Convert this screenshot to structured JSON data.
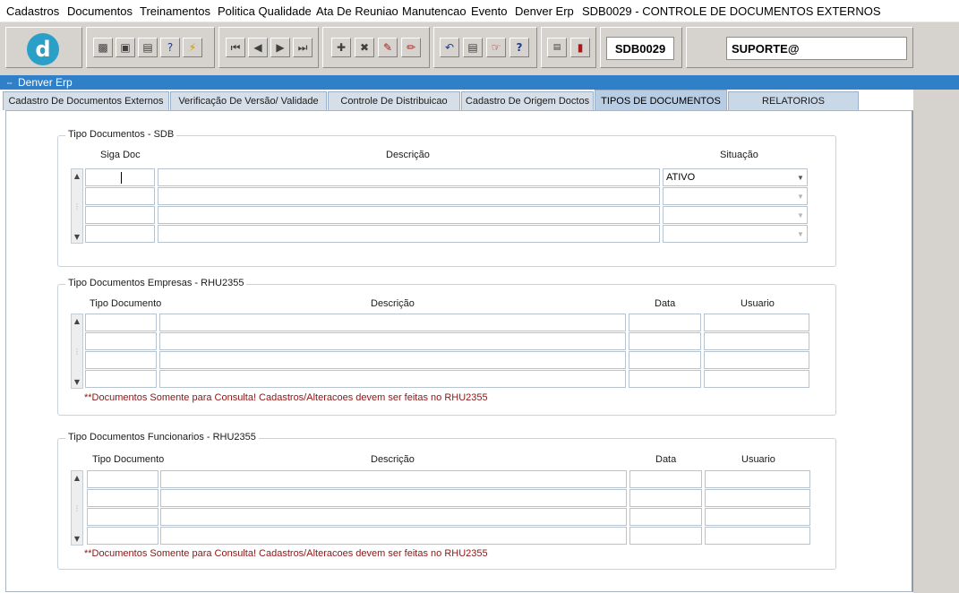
{
  "menubar": {
    "items": [
      "Cadastros",
      "Documentos",
      "Treinamentos",
      "Politica Qualidade",
      "Ata De Reuniao",
      "Manutencao",
      "Evento",
      "Denver Erp"
    ],
    "title": "SDB0029 - CONTROLE DE DOCUMENTOS EXTERNOS"
  },
  "toolbar": {
    "form_code": "SDB0029",
    "user": "SUPORTE@",
    "logo_letter": "d"
  },
  "window": {
    "title": "Denver Erp"
  },
  "tabs": [
    {
      "label": "Cadastro De Documentos Externos",
      "active": false
    },
    {
      "label": "Verificação De Versão/ Validade",
      "active": false
    },
    {
      "label": "Controle De Distribuicao",
      "active": false
    },
    {
      "label": "Cadastro De Origem Doctos",
      "active": false
    },
    {
      "label": "TIPOS DE DOCUMENTOS",
      "active": true
    },
    {
      "label": "RELATORIOS",
      "active": false
    }
  ],
  "section_sdb": {
    "title": "Tipo Documentos - SDB",
    "columns": [
      "Siga Doc",
      "Descrição",
      "Situação"
    ],
    "rows": [
      {
        "siga_doc": "",
        "descricao": "",
        "situacao": "ATIVO"
      },
      {
        "siga_doc": "",
        "descricao": "",
        "situacao": ""
      },
      {
        "siga_doc": "",
        "descricao": "",
        "situacao": ""
      },
      {
        "siga_doc": "",
        "descricao": "",
        "situacao": ""
      }
    ]
  },
  "section_empresas": {
    "title": "Tipo Documentos Empresas - RHU2355",
    "columns": [
      "Tipo Documento",
      "Descrição",
      "Data",
      "Usuario"
    ],
    "note": "**Documentos Somente para Consulta! Cadastros/Alteracoes devem ser feitas no RHU2355"
  },
  "section_funcionarios": {
    "title": "Tipo Documentos Funcionarios - RHU2355",
    "columns": [
      "Tipo Documento",
      "Descrição",
      "Data",
      "Usuario"
    ],
    "note": "**Documentos Somente para Consulta! Cadastros/Alteracoes devem ser feitas no RHU2355"
  },
  "colors": {
    "titlebar": "#2f80c8",
    "active_tab": "#b8cde3",
    "note_text": "#8b1515",
    "toolbar_bg": "#d6d3ce"
  }
}
